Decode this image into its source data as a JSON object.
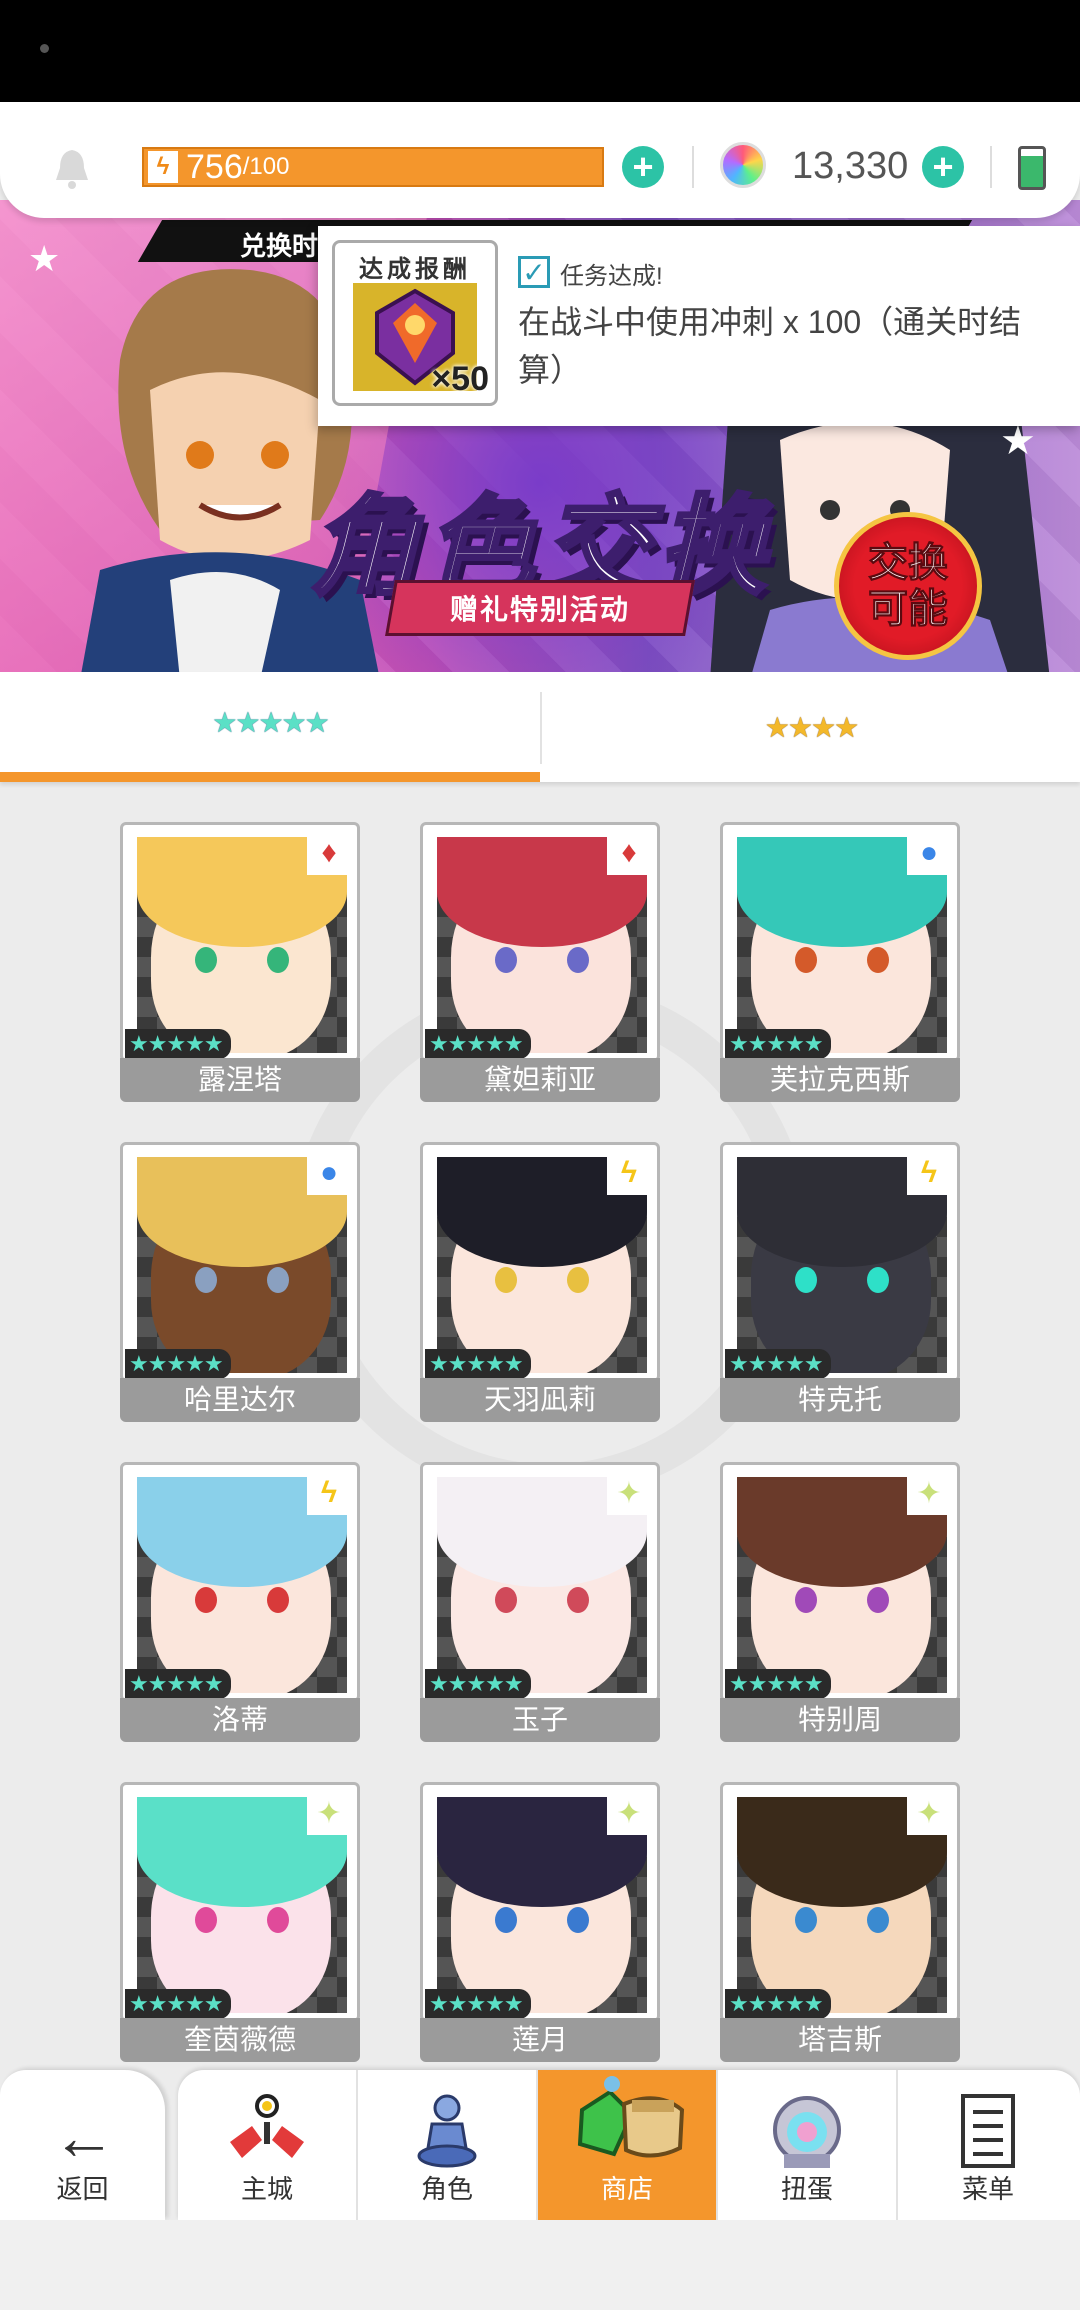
{
  "topbar": {
    "energy_value": "756",
    "energy_max": "/100",
    "gems": "13,330"
  },
  "banner": {
    "top_label": "兑换时",
    "title": "角色交换",
    "ribbon": "赠礼特别活动",
    "badge_line1": "交换",
    "badge_line2": "可能"
  },
  "notification": {
    "reward_title": "达成报酬",
    "reward_count": "×50",
    "status": "任务达成!",
    "mission": "在战斗中使用冲刺 x 100（通关时结算）"
  },
  "tabs": {
    "five_star": "★★★★★",
    "four_star": "★★★★"
  },
  "characters": [
    {
      "name": "露涅塔",
      "stars": "★★★★★",
      "element": "fire"
    },
    {
      "name": "黛妲莉亚",
      "stars": "★★★★★",
      "element": "fire"
    },
    {
      "name": "芙拉克西斯",
      "stars": "★★★★★",
      "element": "water"
    },
    {
      "name": "哈里达尔",
      "stars": "★★★★★",
      "element": "water"
    },
    {
      "name": "天羽凪莉",
      "stars": "★★★★★",
      "element": "thunder"
    },
    {
      "name": "特克托",
      "stars": "★★★★★",
      "element": "thunder"
    },
    {
      "name": "洛蒂",
      "stars": "★★★★★",
      "element": "thunder"
    },
    {
      "name": "玉子",
      "stars": "★★★★★",
      "element": "light"
    },
    {
      "name": "特别周",
      "stars": "★★★★★",
      "element": "light"
    },
    {
      "name": "奎茵薇德",
      "stars": "★★★★★",
      "element": "light"
    },
    {
      "name": "莲月",
      "stars": "★★★★★",
      "element": "light"
    },
    {
      "name": "塔吉斯",
      "stars": "★★★★★",
      "element": "light"
    }
  ],
  "nav": {
    "back": "返回",
    "town": "主城",
    "character": "角色",
    "shop": "商店",
    "gacha": "扭蛋",
    "menu": "菜单"
  },
  "colors": {
    "accent": "#f4962c",
    "plus": "#2cc3a6",
    "fire": "#d83a3a",
    "water": "#3a86e8",
    "thunder": "#f5c518",
    "light": "#c9e07a"
  }
}
